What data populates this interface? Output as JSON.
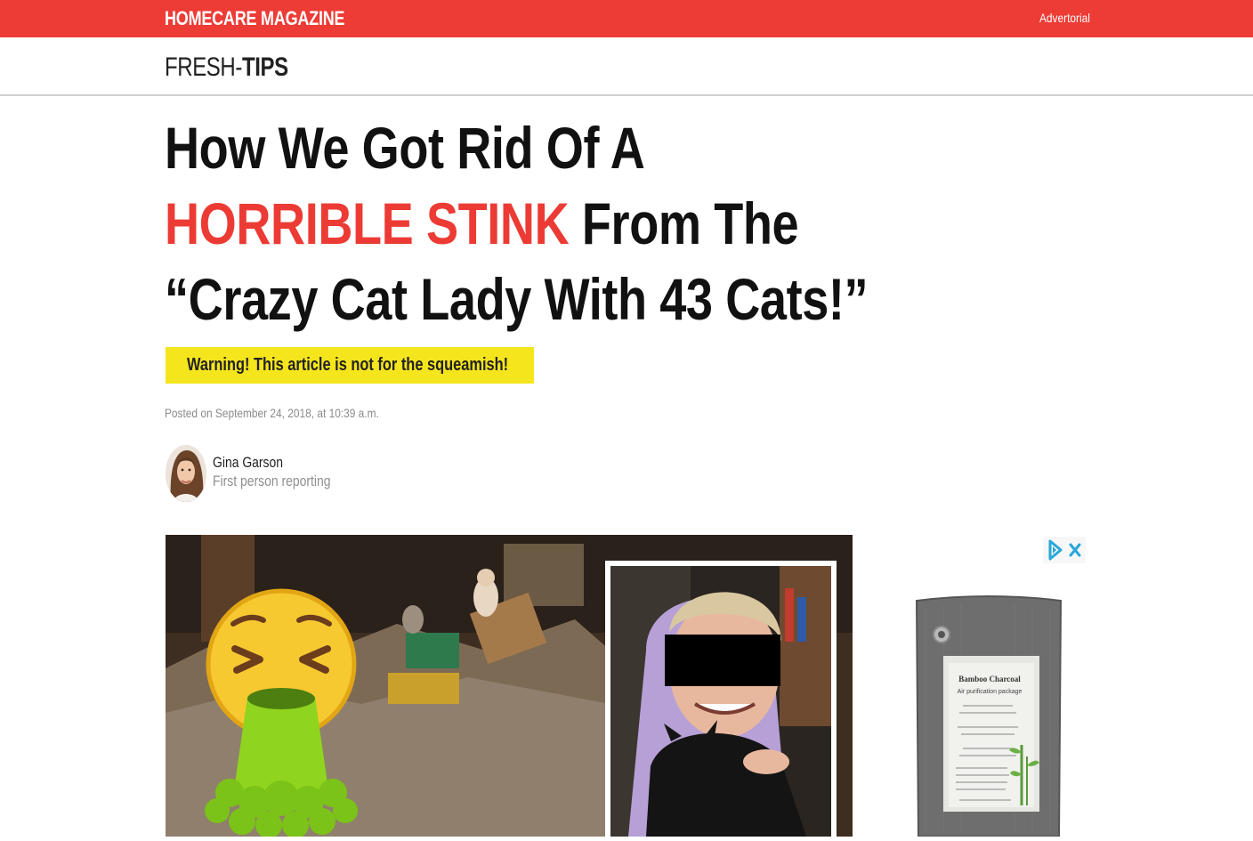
{
  "header": {
    "brand": "HOMECARE MAGAZINE",
    "advertorial_label": "Advertorial",
    "bar_color": "#ed3b35"
  },
  "subnav": {
    "logo_part1": "FRESH-",
    "logo_part2": "TIPS"
  },
  "article": {
    "headline_line1": "How We Got Rid Of A",
    "headline_highlight": "HORRIBLE STINK",
    "headline_line2_rest": " From The",
    "headline_line3": "“Crazy Cat Lady With 43 Cats!”",
    "highlight_color": "#ec3b34",
    "warning": "Warning! This article is not for the squeamish!",
    "posted": "Posted on September 24, 2018, at 10:39 a.m.",
    "author": {
      "name": "Gina Garson",
      "role": "First person reporting"
    }
  },
  "ad": {
    "product_title": "Bamboo Charcoal",
    "product_subtitle": "Air purification package",
    "icons": [
      "adchoices-icon",
      "close-icon"
    ]
  }
}
